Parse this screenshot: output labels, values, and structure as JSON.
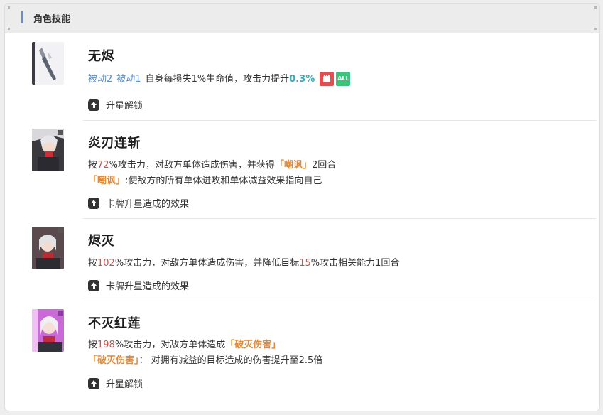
{
  "section": {
    "title": "角色技能"
  },
  "skills": [
    {
      "name": "无烬",
      "line1": {
        "tag1": "被动2",
        "tag2": "被动1",
        "text": "自身每损失1%生命值，攻击力提升",
        "value": "0.3%",
        "badge_red_icon": "fist-icon",
        "badge_green_label": "ALL"
      },
      "upgrade_label": "升星解锁"
    },
    {
      "name": "炎刃连斩",
      "line1": {
        "p1": "按",
        "value": "72",
        "p2": "%攻击力，对敌方单体造成伤害，并获得",
        "keyword": "「嘲讽」",
        "p3": "2回合"
      },
      "line2": {
        "keyword": "「嘲讽」",
        "text": ":使敌方的所有单体进攻和单体减益效果指向自己"
      },
      "upgrade_label": "卡牌升星造成的效果"
    },
    {
      "name": "烬灭",
      "line1": {
        "p1": "按",
        "value": "102",
        "p2": "%攻击力，对敌方单体造成伤害，并降低目标",
        "value2": "15",
        "p3": "%攻击相关能力1回合"
      },
      "upgrade_label": "卡牌升星造成的效果"
    },
    {
      "name": "不灭红莲",
      "line1": {
        "p1": "按",
        "value": "198",
        "p2": "%攻击力，对敌方单体造成",
        "keyword": "「破灭伤害」"
      },
      "line2": {
        "keyword": "「破灭伤害」",
        "text": "： 对拥有减益的目标造成的伤害提升至2.5倍"
      },
      "upgrade_label": "升星解锁"
    }
  ],
  "colors": {
    "accent_bar": "#7a89b4",
    "link_blue": "#5a8fd0",
    "number_red": "#d94a4a",
    "number_teal": "#3aa8b8",
    "keyword_orange": "#e08a3a",
    "badge_red": "#e05050",
    "badge_green": "#3cc47a"
  }
}
